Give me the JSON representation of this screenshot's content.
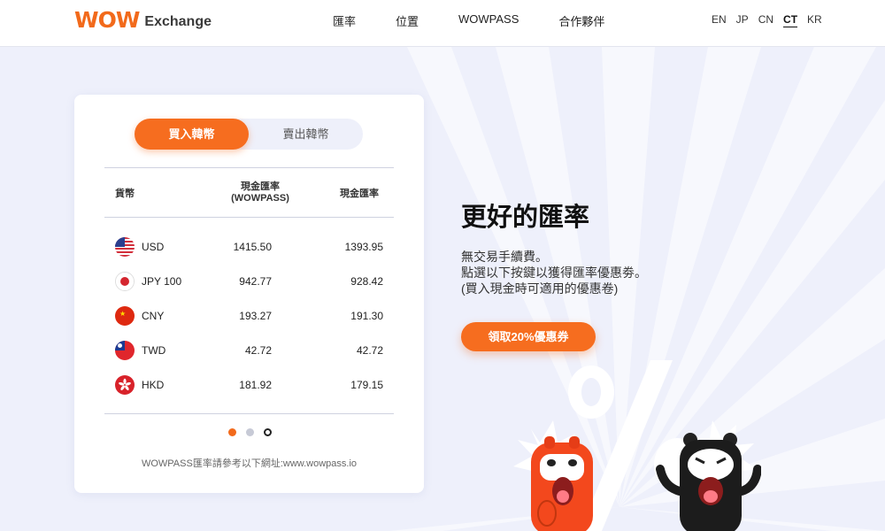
{
  "brand": {
    "wow": "WOW",
    "name": "Exchange",
    "accent": "#f26a1b"
  },
  "nav": {
    "items": [
      "匯率",
      "位置",
      "WOWPASS",
      "合作夥伴"
    ]
  },
  "languages": {
    "items": [
      "EN",
      "JP",
      "CN",
      "CT",
      "KR"
    ],
    "active": "CT"
  },
  "tabs": {
    "buy": "買入韓幣",
    "sell": "賣出韓幣"
  },
  "table": {
    "headers": {
      "currency": "貨幣",
      "wowpass_line1": "現金匯率",
      "wowpass_line2": "(WOWPASS)",
      "cash": "現金匯率"
    },
    "rows": [
      {
        "flag": "us-flag-icon",
        "currency": "USD",
        "wowpass": "1415.50",
        "cash": "1393.95"
      },
      {
        "flag": "jp-flag-icon",
        "currency": "JPY 100",
        "wowpass": "942.77",
        "cash": "928.42"
      },
      {
        "flag": "cn-flag-icon",
        "currency": "CNY",
        "wowpass": "193.27",
        "cash": "191.30"
      },
      {
        "flag": "tw-flag-icon",
        "currency": "TWD",
        "wowpass": "42.72",
        "cash": "42.72"
      },
      {
        "flag": "hk-flag-icon",
        "currency": "HKD",
        "wowpass": "181.92",
        "cash": "179.15"
      }
    ],
    "footnote": "WOWPASS匯率請參考以下網址:www.wowpass.io"
  },
  "pagination": {
    "pages": 3,
    "active": 1
  },
  "promo": {
    "title": "更好的匯率",
    "lines": [
      "無交易手續費。",
      "點選以下按鍵以獲得匯率優惠劵。",
      "(買入現金時可適用的優惠卷)"
    ],
    "button": "領取20%優惠券"
  }
}
